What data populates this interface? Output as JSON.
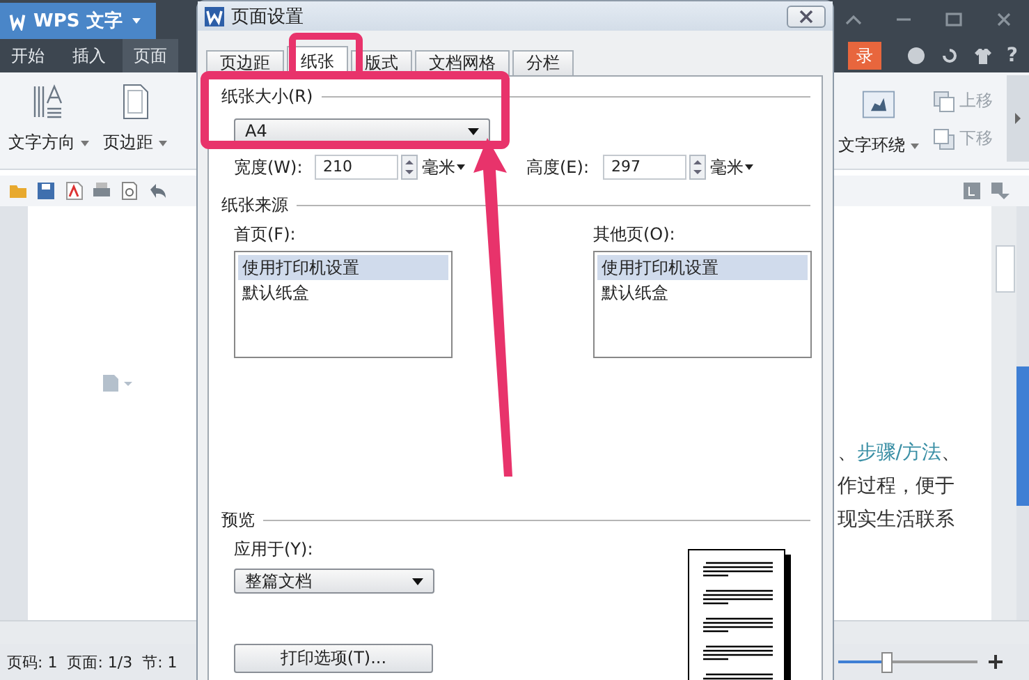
{
  "app": {
    "title": "WPS 文字",
    "menu": [
      {
        "label": "开始",
        "selected": false
      },
      {
        "label": "插入",
        "selected": false
      },
      {
        "label": "页面",
        "selected": true
      }
    ],
    "login": "录",
    "help": "?",
    "ribbon_left": [
      "文字方向",
      "页边距"
    ],
    "ribbon_right": {
      "wrap": "文字环绕",
      "up": "上移",
      "down": "下移"
    },
    "doc_lines": [
      [
        {
          "text": "、",
          "link": false
        },
        {
          "text": "步骤/方法",
          "link": true
        },
        {
          "text": "、",
          "link": false
        }
      ],
      [
        {
          "text": "作过程，便于",
          "link": false
        }
      ],
      [
        {
          "text": "现实生活联系",
          "link": false
        }
      ]
    ],
    "status": [
      "页码: 1",
      "页面: 1/3",
      "节: 1"
    ],
    "zoom": {
      "level": 0.35
    }
  },
  "dialog": {
    "title": "页面设置",
    "tabs": [
      {
        "label": "页边距",
        "selected": false
      },
      {
        "label": "纸张",
        "selected": true
      },
      {
        "label": "版式",
        "selected": false
      },
      {
        "label": "文档网格",
        "selected": false
      },
      {
        "label": "分栏",
        "selected": false
      }
    ],
    "paper_size": {
      "label": "纸张大小(R)",
      "value": "A4"
    },
    "width": {
      "label": "宽度(W):",
      "value": "210",
      "unit": "毫米"
    },
    "height": {
      "label": "高度(E):",
      "value": "297",
      "unit": "毫米"
    },
    "source": {
      "label": "纸张来源",
      "lists": [
        {
          "label": "首页(F):",
          "items": [
            {
              "label": "使用打印机设置",
              "selected": true
            },
            {
              "label": "默认纸盒",
              "selected": false
            }
          ]
        },
        {
          "label": "其他页(O):",
          "items": [
            {
              "label": "使用打印机设置",
              "selected": true
            },
            {
              "label": "默认纸盒",
              "selected": false
            }
          ]
        }
      ]
    },
    "preview": {
      "label": "预览",
      "apply_label": "应用于(Y):",
      "apply_value": "整篇文档"
    },
    "print_options": "打印选项(T)..."
  }
}
